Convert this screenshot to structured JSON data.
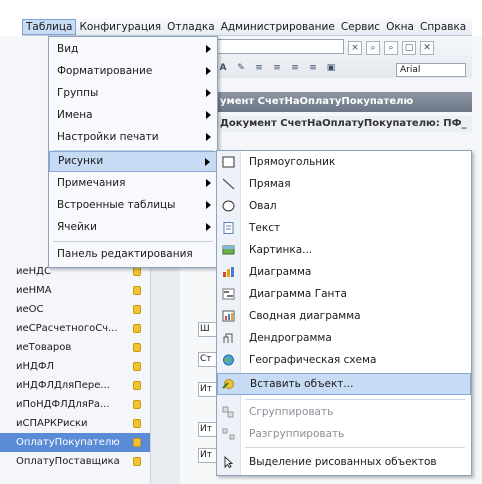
{
  "menubar": {
    "items": [
      {
        "label": "Таблица"
      },
      {
        "label": "Конфигурация"
      },
      {
        "label": "Отладка"
      },
      {
        "label": "Администрирование"
      },
      {
        "label": "Сервис"
      },
      {
        "label": "Окна"
      },
      {
        "label": "Справка"
      }
    ]
  },
  "toolbar": {
    "font_value": "Arial"
  },
  "document": {
    "header": "умент СчетНаОплатуПокупателю",
    "subheader": "Документ СчетНаОплатуПокупателю: ПФ_"
  },
  "tree": {
    "items": [
      {
        "label": "иеНДС"
      },
      {
        "label": "иеНМА"
      },
      {
        "label": "иеОС"
      },
      {
        "label": "иеСРасчетногоСч..."
      },
      {
        "label": "иеТоваров"
      },
      {
        "label": "иНДФЛ"
      },
      {
        "label": "иНДФЛДляПере..."
      },
      {
        "label": "иПоНДФЛДляРа..."
      },
      {
        "label": "иСПАРКРиски"
      },
      {
        "label": "ОплатуПокупателю"
      },
      {
        "label": "ОплатуПоставщика"
      }
    ]
  },
  "mid_cells": [
    "Ш",
    "Ст",
    "Ит",
    "Ит",
    "Ит"
  ],
  "menu_table": {
    "items": [
      {
        "label": "Вид"
      },
      {
        "label": "Форматирование"
      },
      {
        "label": "Группы"
      },
      {
        "label": "Имена"
      },
      {
        "label": "Настройки печати"
      },
      {
        "label": "Рисунки"
      },
      {
        "label": "Примечания"
      },
      {
        "label": "Встроенные таблицы"
      },
      {
        "label": "Ячейки"
      },
      {
        "label": "Панель редактирования"
      }
    ]
  },
  "menu_pictures": {
    "items": [
      {
        "label": "Прямоугольник",
        "icon": "rectangle-icon"
      },
      {
        "label": "Прямая",
        "icon": "line-icon"
      },
      {
        "label": "Овал",
        "icon": "oval-icon"
      },
      {
        "label": "Текст",
        "icon": "text-icon"
      },
      {
        "label": "Картинка...",
        "icon": "picture-icon"
      },
      {
        "label": "Диаграмма",
        "icon": "chart-icon"
      },
      {
        "label": "Диаграмма Ганта",
        "icon": "gantt-chart-icon"
      },
      {
        "label": "Сводная диаграмма",
        "icon": "pivot-chart-icon"
      },
      {
        "label": "Дендрограмма",
        "icon": "dendrogram-icon"
      },
      {
        "label": "Географическая схема",
        "icon": "globe-icon"
      },
      {
        "label": "Вставить объект...",
        "icon": "insert-object-icon"
      },
      {
        "label": "Сгруппировать",
        "icon": "group-icon"
      },
      {
        "label": "Разгруппировать",
        "icon": "ungroup-icon"
      },
      {
        "label": "Выделение рисованных объектов",
        "icon": "select-pointer-icon"
      }
    ]
  },
  "colors": {
    "highlight": "#c7dbf4",
    "highlight_border": "#86a9d6",
    "selection": "#5a8bd6"
  }
}
